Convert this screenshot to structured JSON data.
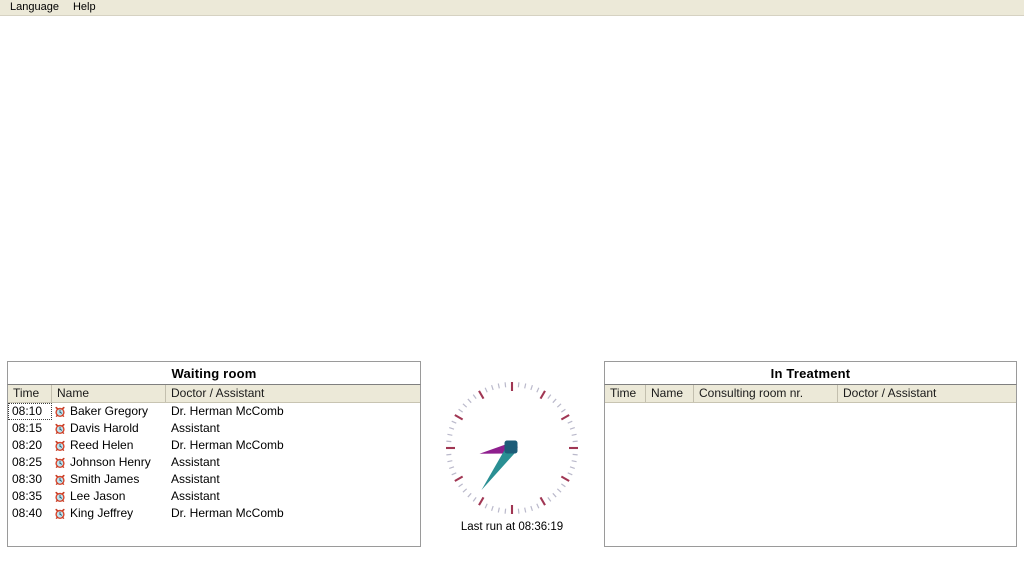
{
  "menu": {
    "items": [
      {
        "label": "Language",
        "name": "menu-language"
      },
      {
        "label": "Help",
        "name": "menu-help"
      }
    ]
  },
  "waiting_room": {
    "title": "Waiting room",
    "columns": [
      "Time",
      "Name",
      "Doctor / Assistant"
    ],
    "rows": [
      {
        "time": "08:10",
        "icon": "alarm-clock-icon",
        "name": "Baker Gregory",
        "doctor": "Dr. Herman McComb",
        "focused": true
      },
      {
        "time": "08:15",
        "icon": "alarm-clock-icon",
        "name": "Davis Harold",
        "doctor": "Assistant",
        "focused": false
      },
      {
        "time": "08:20",
        "icon": "alarm-clock-icon",
        "name": "Reed Helen",
        "doctor": "Dr. Herman McComb",
        "focused": false
      },
      {
        "time": "08:25",
        "icon": "alarm-clock-icon",
        "name": "Johnson Henry",
        "doctor": "Assistant",
        "focused": false
      },
      {
        "time": "08:30",
        "icon": "alarm-clock-icon",
        "name": "Smith James",
        "doctor": "Assistant",
        "focused": false
      },
      {
        "time": "08:35",
        "icon": "alarm-clock-icon",
        "name": "Lee Jason",
        "doctor": "Assistant",
        "focused": false
      },
      {
        "time": "08:40",
        "icon": "alarm-clock-icon",
        "name": "King Jeffrey",
        "doctor": "Dr. Herman McComb",
        "focused": false
      }
    ]
  },
  "in_treatment": {
    "title": "In Treatment",
    "columns": [
      "Time",
      "Name",
      "Consulting room nr.",
      "Doctor / Assistant"
    ],
    "rows": []
  },
  "clock": {
    "caption": "Last run at 08:36:19",
    "hour_hand_angle": 260,
    "minute_hand_angle": 216,
    "hour_hand_color": "#8e1f8e",
    "minute_hand_color": "#2a8f93",
    "hub_color": "#1d5c78",
    "hour_tick_color": "#9b2b4a",
    "minute_tick_color": "#9d9bb5"
  },
  "colors": {
    "menubar_bg": "#ece9d8",
    "header_bg": "#ece9d8",
    "panel_border": "#9a9a9a",
    "page_bg": "#ffffff"
  }
}
